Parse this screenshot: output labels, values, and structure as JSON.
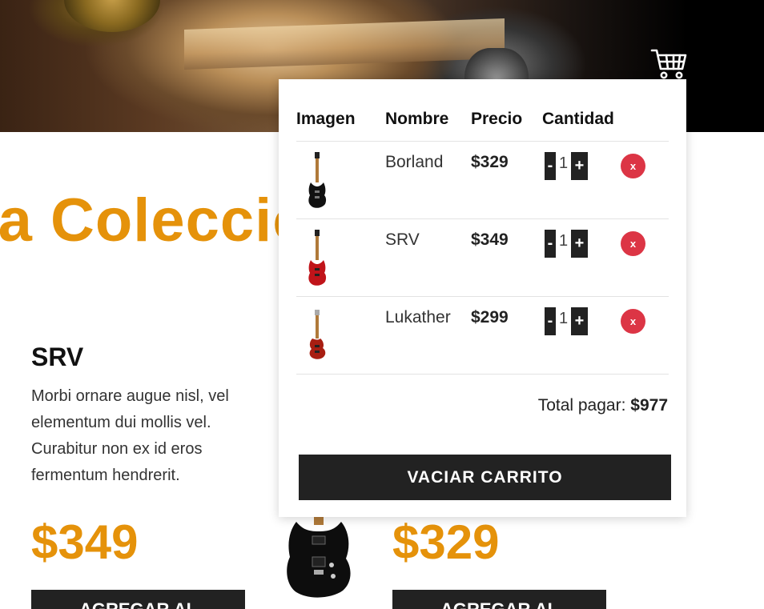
{
  "header": {
    "cart_icon": "shopping-cart-icon"
  },
  "collection": {
    "title": "ra Colección"
  },
  "products": [
    {
      "name": "SRV",
      "description": "Morbi ornare augue nisl, vel elementum dui mollis vel. Curabitur non ex id eros fermentum hendrerit.",
      "price": "$349",
      "button": "AGREGAR AL"
    },
    {
      "name": "",
      "description": "",
      "price": "$329",
      "button": "AGREGAR AL"
    }
  ],
  "cart": {
    "headers": {
      "image": "Imagen",
      "name": "Nombre",
      "price": "Precio",
      "quantity": "Cantidad"
    },
    "items": [
      {
        "name": "Borland",
        "price": "$329",
        "qty": "1",
        "minus": "-",
        "plus": "+",
        "remove": "x",
        "color": "#111111"
      },
      {
        "name": "SRV",
        "price": "$349",
        "qty": "1",
        "minus": "-",
        "plus": "+",
        "remove": "x",
        "color": "#c0141a"
      },
      {
        "name": "Lukather",
        "price": "$299",
        "qty": "1",
        "minus": "-",
        "plus": "+",
        "remove": "x",
        "color": "#a81e12"
      }
    ],
    "total_label": "Total pagar:",
    "total_value": "$977",
    "empty_button": "VACIAR CARRITO"
  },
  "colors": {
    "accent": "#e5920a",
    "dark": "#222222",
    "remove": "#dc3545"
  }
}
